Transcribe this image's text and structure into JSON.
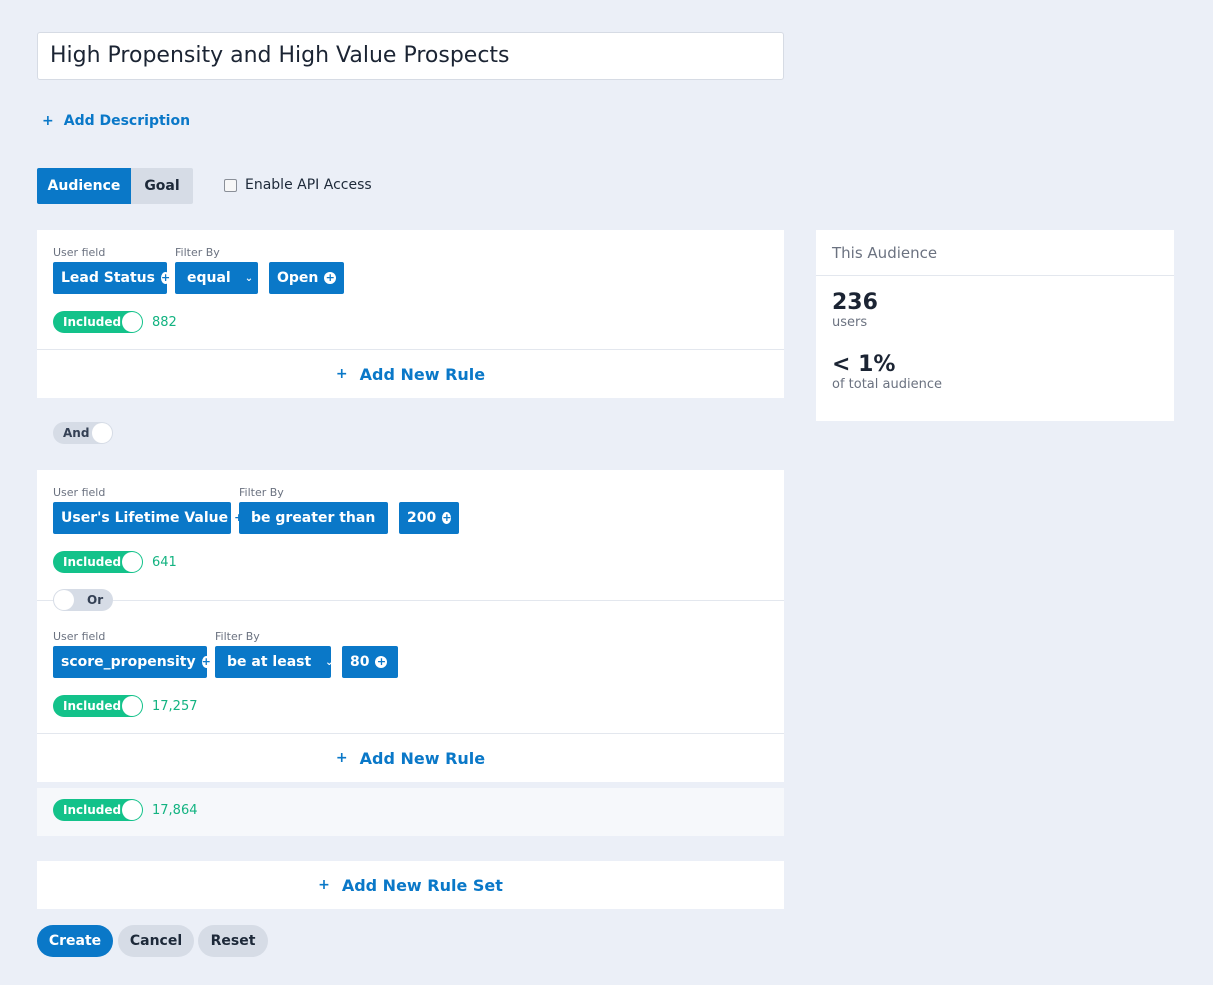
{
  "segment_name": "High Propensity and High Value Prospects",
  "add_description": "Add Description",
  "tabs": [
    "Audience",
    "Goal"
  ],
  "api_access_label": "Enable API Access",
  "labels": {
    "user_field": "User field",
    "filter_by": "Filter By"
  },
  "ruleset1": {
    "rule": {
      "field": "Lead Status",
      "operator": "equal",
      "value": "Open",
      "status": "Included",
      "count": "882"
    },
    "add_rule": "Add New Rule"
  },
  "connector": "And",
  "ruleset2": {
    "rule1": {
      "field": "User's Lifetime Value",
      "operator": "be greater than",
      "value": "200",
      "status": "Included",
      "count": "641"
    },
    "connector": "Or",
    "rule2": {
      "field": "score_propensity",
      "operator": "be at least",
      "value": "80",
      "status": "Included",
      "count": "17,257"
    },
    "add_rule": "Add New Rule",
    "total_status": "Included",
    "total_count": "17,864"
  },
  "add_rule_set": "Add New Rule Set",
  "summary": {
    "title": "This Audience",
    "users_count": "236",
    "users_label": "users",
    "percent": "< 1%",
    "percent_label": "of total audience"
  },
  "buttons": {
    "create": "Create",
    "cancel": "Cancel",
    "reset": "Reset"
  },
  "colors": {
    "primary": "#0a78c8",
    "included": "#13c28a",
    "background": "#ebeff7"
  }
}
